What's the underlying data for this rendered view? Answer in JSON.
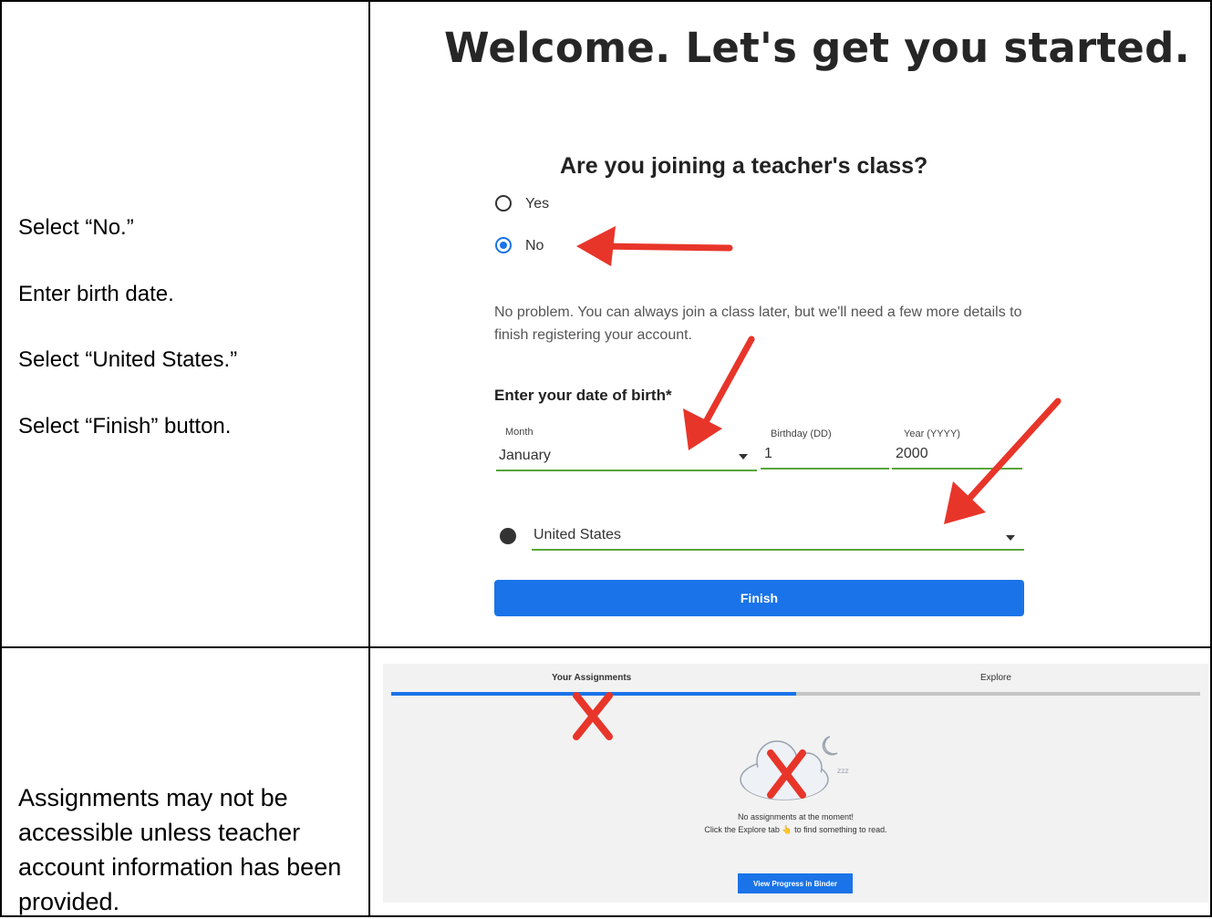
{
  "instructions": {
    "step1": "Select “No.”",
    "step2": "Enter birth date.",
    "step3": "Select “United States.”",
    "step4": "Select “Finish” button.",
    "note": "Assignments may not be accessible unless teacher account information has been provided."
  },
  "registration": {
    "heading": "Welcome. Let's get you started.",
    "question": "Are you joining a teacher's class?",
    "options": [
      {
        "label": "Yes",
        "selected": false
      },
      {
        "label": "No",
        "selected": true
      }
    ],
    "message": "No problem. You can always join a class later, but we'll need a few more details to finish registering your account.",
    "dob_label": "Enter your date of birth*",
    "month": {
      "label": "Month",
      "value": "January"
    },
    "day": {
      "label": "Birthday (DD)",
      "value": "1"
    },
    "year": {
      "label": "Year (YYYY)",
      "value": "2000"
    },
    "country": {
      "value": "United States",
      "icon": "globe-icon"
    },
    "finish_label": "Finish",
    "accent_color": "#1a73e8",
    "field_underline_color": "#59a63a",
    "arrow_color": "#e8352a"
  },
  "assignments": {
    "tabs": [
      {
        "label": "Your Assignments",
        "active": true
      },
      {
        "label": "Explore",
        "active": false
      }
    ],
    "empty_line1": "No assignments at the moment!",
    "empty_line2": "Click the Explore tab 👆 to find something to read.",
    "button_label": "View Progress in Binder",
    "mark_color": "#e8352a"
  }
}
